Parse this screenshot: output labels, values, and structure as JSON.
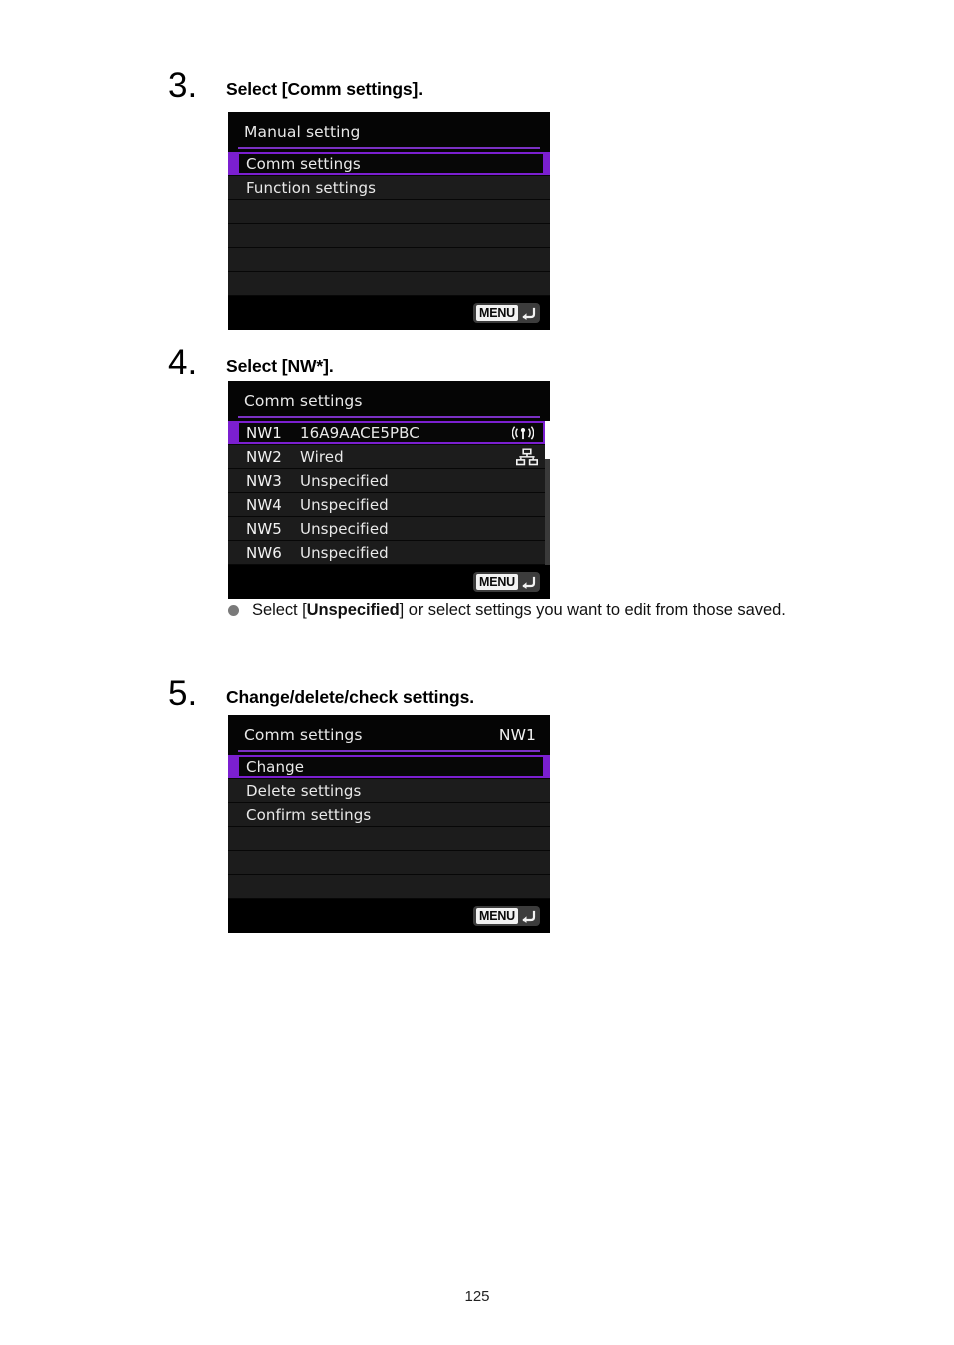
{
  "page": {
    "number": "125"
  },
  "steps": [
    {
      "num": "3.",
      "title": "Select [Comm settings].",
      "screen": {
        "title": "Manual setting",
        "title_right": "",
        "rows": [
          {
            "label": "Comm settings",
            "selected": true
          },
          {
            "label": "Function settings",
            "selected": false
          }
        ],
        "empty_rows": 4,
        "footer_button": "MENU",
        "footer_icon": "return-arrow-icon"
      }
    },
    {
      "num": "4.",
      "title": "Select [NW*].",
      "screen": {
        "title": "Comm settings",
        "title_right": "",
        "rows": [
          {
            "code": "NW1",
            "value": "16A9AACE5PBC",
            "icon": "wifi-icon",
            "selected": true
          },
          {
            "code": "NW2",
            "value": "Wired",
            "icon": "wired-lan-icon",
            "selected": false
          },
          {
            "code": "NW3",
            "value": "Unspecified",
            "icon": "",
            "selected": false
          },
          {
            "code": "NW4",
            "value": "Unspecified",
            "icon": "",
            "selected": false
          },
          {
            "code": "NW5",
            "value": "Unspecified",
            "icon": "",
            "selected": false
          },
          {
            "code": "NW6",
            "value": "Unspecified",
            "icon": "",
            "selected": false
          }
        ],
        "scrollbar": true,
        "footer_button": "MENU",
        "footer_icon": "return-arrow-icon"
      },
      "bullet": {
        "icon": "bullet-dot-icon",
        "text_before": "Select [",
        "text_bold": "Unspecified",
        "text_after": "] or select settings you want to edit from those saved."
      }
    },
    {
      "num": "5.",
      "title": "Change/delete/check settings.",
      "screen": {
        "title": "Comm settings",
        "title_right": "NW1",
        "rows": [
          {
            "label": "Change",
            "selected": true
          },
          {
            "label": "Delete settings",
            "selected": false
          },
          {
            "label": "Confirm settings",
            "selected": false
          }
        ],
        "empty_rows": 3,
        "footer_button": "MENU",
        "footer_icon": "return-arrow-icon"
      }
    }
  ],
  "colors": {
    "accent_purple": "#7b1fd0",
    "title_underline": "#7b31c4",
    "screen_bg": "#000000",
    "row_bg": "#1c1c1c",
    "bullet_gray": "#7a7a7a"
  }
}
